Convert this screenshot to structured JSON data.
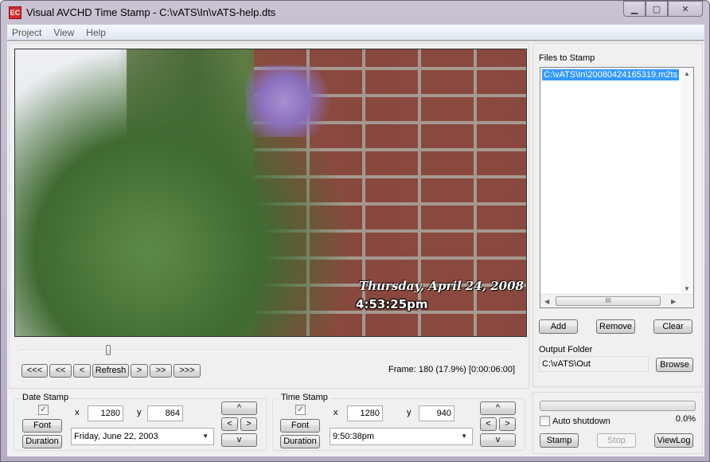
{
  "window": {
    "title": "Visual AVCHD Time Stamp - C:\\vATS\\In\\vATS-help.dts",
    "icon_text": "EC",
    "controls": {
      "minimize": "▁",
      "maximize": "▢",
      "close": "✕"
    }
  },
  "menu": {
    "items": [
      "Project",
      "View",
      "Help"
    ]
  },
  "preview": {
    "overlay_date": "Thursday, April 24, 2008",
    "overlay_time": "4:53:25pm",
    "slider_position_percent": 17.9
  },
  "nav": {
    "buttons": [
      "<<<",
      "<<",
      "<",
      "Refresh",
      ">",
      ">>",
      ">>>"
    ],
    "frame_info": "Frame: 180 (17.9%) [0:00:06:00]"
  },
  "files": {
    "title": "Files to Stamp",
    "items": [
      "C:\\vATS\\In\\20080424165319.m2ts"
    ],
    "scroll_thumb_grip": "III",
    "scroll_up": "▲",
    "scroll_down": "▼",
    "scroll_left": "◀",
    "scroll_right": "▶",
    "add_label": "Add",
    "remove_label": "Remove",
    "clear_label": "Clear",
    "output_label": "Output Folder",
    "output_value": "C:\\vATS\\Out",
    "browse_label": "Browse"
  },
  "date_stamp": {
    "title": "Date Stamp",
    "enabled": true,
    "check_glyph": "✓",
    "font_label": "Font",
    "duration_label": "Duration",
    "x_label": "x",
    "x_value": "1280",
    "y_label": "y",
    "y_value": "864",
    "format_value": "Friday, June 22, 2003",
    "caret": "▼",
    "up": "^",
    "left": "<",
    "right": ">",
    "down": "v"
  },
  "time_stamp": {
    "title": "Time Stamp",
    "enabled": true,
    "check_glyph": "✓",
    "font_label": "Font",
    "duration_label": "Duration",
    "x_label": "x",
    "x_value": "1280",
    "y_label": "y",
    "y_value": "940",
    "format_value": "9:50:38pm",
    "caret": "▼",
    "up": "^",
    "left": "<",
    "right": ">",
    "down": "v"
  },
  "process": {
    "progress_percent": 0.0,
    "progress_text": "0.0%",
    "auto_shutdown_label": "Auto shutdown",
    "auto_shutdown_checked": false,
    "stamp_label": "Stamp",
    "stop_label": "Stop",
    "viewlog_label": "ViewLog"
  }
}
